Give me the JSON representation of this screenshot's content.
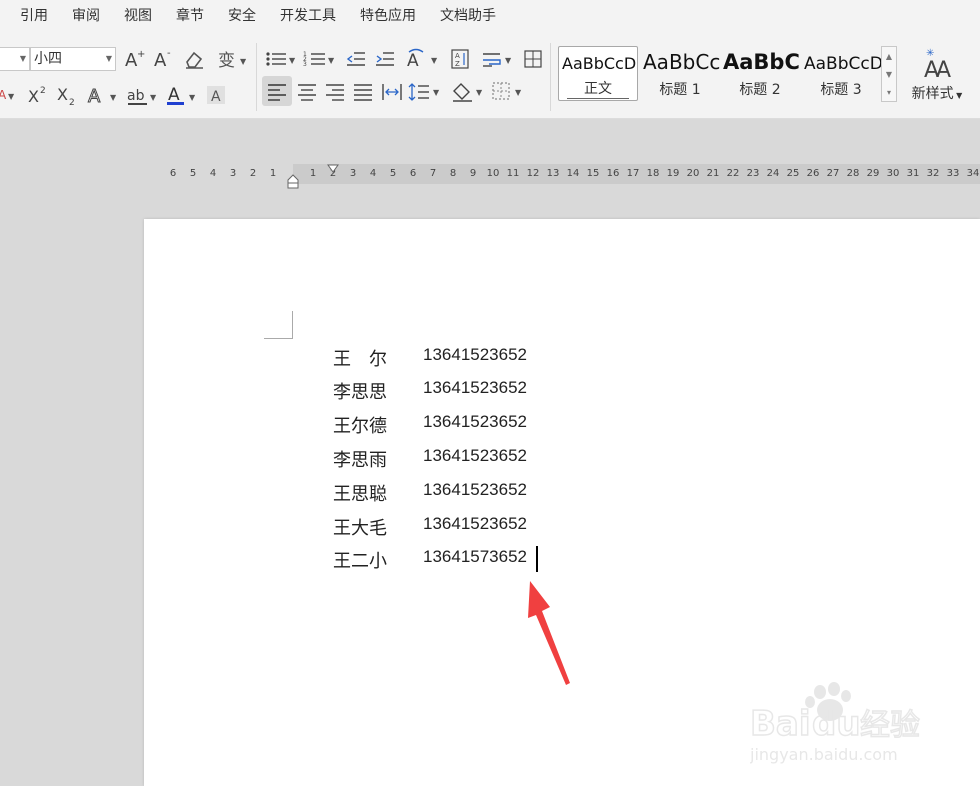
{
  "menu": [
    "引用",
    "审阅",
    "视图",
    "章节",
    "安全",
    "开发工具",
    "特色应用",
    "文档助手"
  ],
  "toolbar": {
    "font_size_value": "小四",
    "styles": [
      {
        "sample": "AaBbCcDd",
        "name": "正文"
      },
      {
        "sample": "AaBbCc",
        "name": "标题 1"
      },
      {
        "sample": "AaBbC",
        "name": "标题 2"
      },
      {
        "sample": "AaBbCcDd",
        "name": "标题 3"
      }
    ],
    "new_style_label": "新样式",
    "colors": {
      "font_color_underline": "#1f3fd0",
      "highlight": "#e0e0e0"
    }
  },
  "ruler": {
    "left_ticks": [
      "6",
      "5",
      "4",
      "3",
      "2",
      "1"
    ],
    "right_ticks": [
      "1",
      "2",
      "3",
      "4",
      "5",
      "6",
      "7",
      "8",
      "9",
      "10",
      "11",
      "12",
      "13",
      "14",
      "15",
      "16",
      "17",
      "18",
      "19",
      "20",
      "21",
      "22",
      "23",
      "24",
      "25",
      "26",
      "27",
      "28",
      "29",
      "30",
      "31",
      "32",
      "33",
      "34"
    ]
  },
  "document": {
    "rows": [
      {
        "name": "王　尔",
        "phone": "13641523652"
      },
      {
        "name": "李思思",
        "phone": "13641523652"
      },
      {
        "name": "王尔德",
        "phone": "13641523652"
      },
      {
        "name": "李思雨",
        "phone": "13641523652"
      },
      {
        "name": "王思聪",
        "phone": "13641523652"
      },
      {
        "name": "王大毛",
        "phone": "13641523652"
      },
      {
        "name": "王二小",
        "phone": "13641573652"
      }
    ]
  },
  "annotation": {
    "arrow_color": "#f04040"
  },
  "watermark": {
    "brand": "Baidu经验",
    "url": "jingyan.baidu.com"
  }
}
